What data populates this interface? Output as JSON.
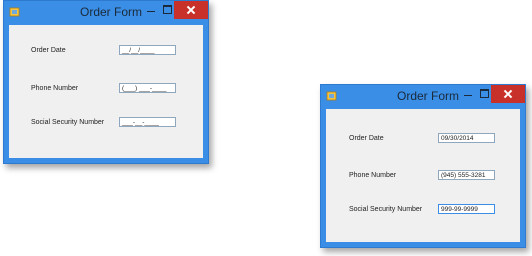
{
  "windows": [
    {
      "title": "Order Form",
      "fields": [
        {
          "label": "Order Date",
          "value": "__/__/____"
        },
        {
          "label": "Phone Number",
          "value": "(___) ___-____"
        },
        {
          "label": "Social Security Number",
          "value": "___-__-____"
        }
      ]
    },
    {
      "title": "Order Form",
      "fields": [
        {
          "label": "Order Date",
          "value": "09/30/2014"
        },
        {
          "label": "Phone Number",
          "value": "(945) 555-3281"
        },
        {
          "label": "Social Security Number",
          "value": "999-99-9999"
        }
      ]
    }
  ],
  "colors": {
    "title_bar": "#3a8ee6",
    "close_button": "#c7312a",
    "client_area": "#f0f0f0"
  }
}
